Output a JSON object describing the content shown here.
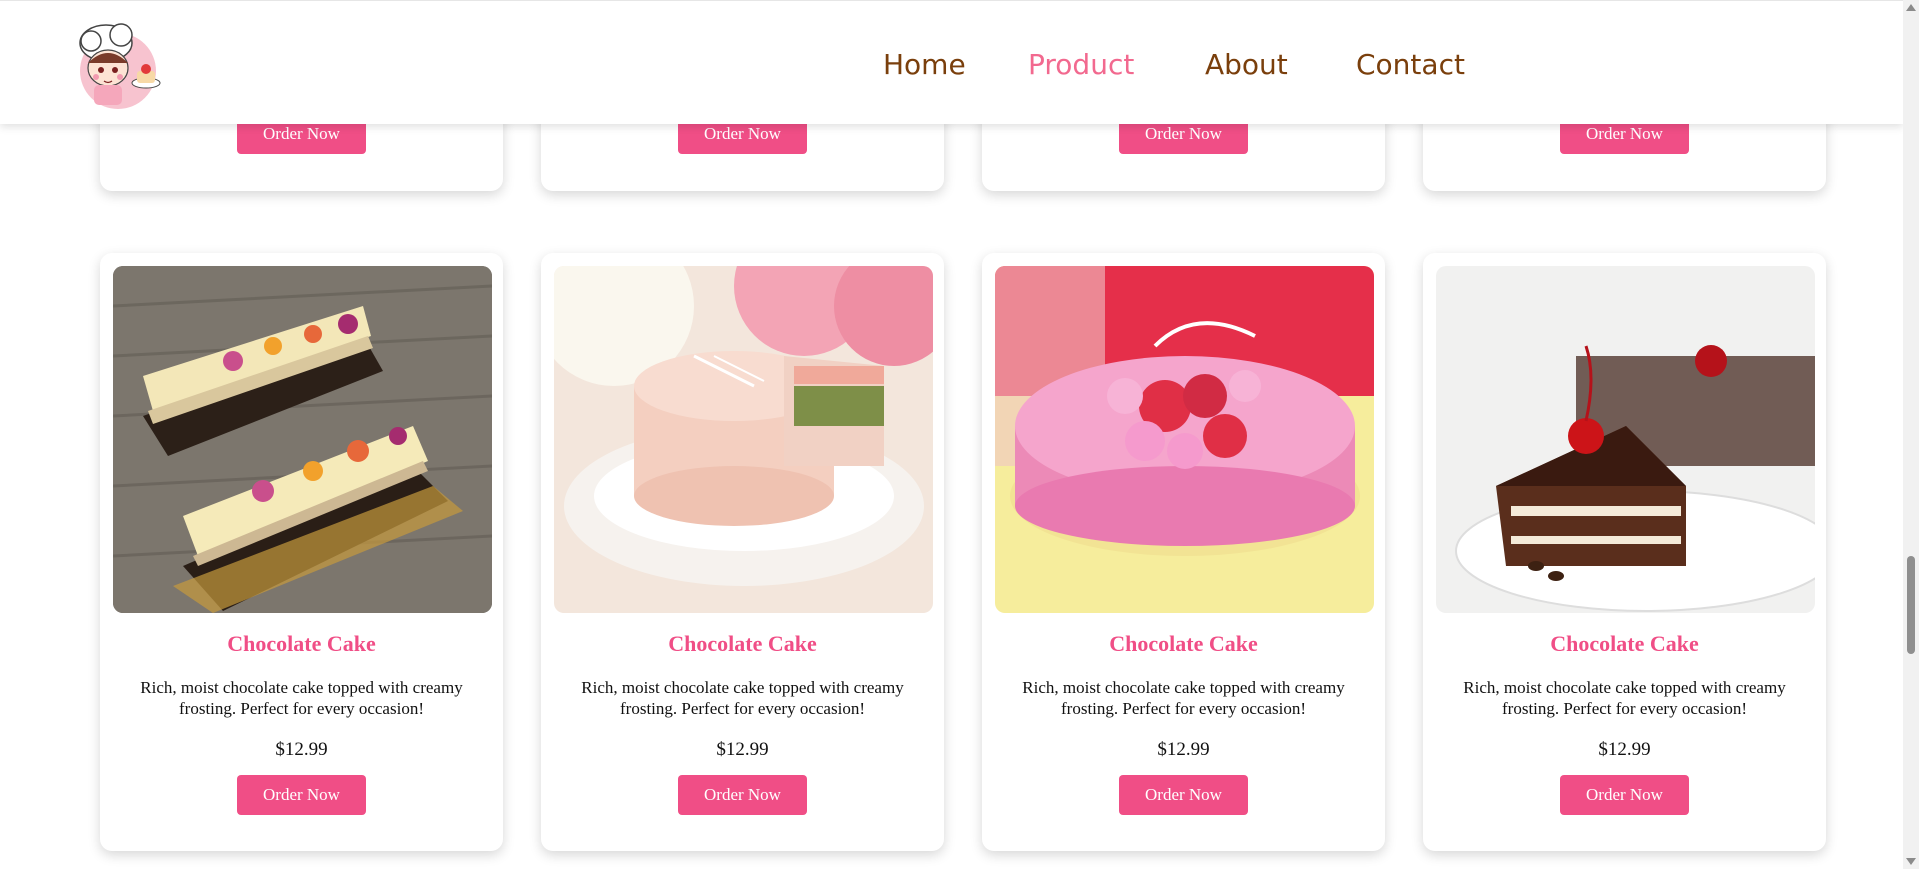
{
  "header": {
    "logo_icon": "chef-girl-logo",
    "nav": [
      {
        "label": "Home",
        "active": false
      },
      {
        "label": "Product",
        "active": true
      },
      {
        "label": "About",
        "active": false
      },
      {
        "label": "Contact",
        "active": false
      }
    ]
  },
  "top_row": [
    {
      "button": "Order Now"
    },
    {
      "button": "Order Now"
    },
    {
      "button": "Order Now"
    },
    {
      "button": "Order Now"
    }
  ],
  "products": [
    {
      "image_icon": "fruit-tart-icon",
      "title": "Chocolate Cake",
      "description": "Rich, moist chocolate cake topped with creamy frosting. Perfect for every occasion!",
      "price": "$12.99",
      "button": "Order Now"
    },
    {
      "image_icon": "peach-mousse-cake-icon",
      "title": "Chocolate Cake",
      "description": "Rich, moist chocolate cake topped with creamy frosting. Perfect for every occasion!",
      "price": "$12.99",
      "button": "Order Now"
    },
    {
      "image_icon": "strawberry-macaron-cake-icon",
      "title": "Chocolate Cake",
      "description": "Rich, moist chocolate cake topped with creamy frosting. Perfect for every occasion!",
      "price": "$12.99",
      "button": "Order Now"
    },
    {
      "image_icon": "black-forest-cake-icon",
      "title": "Chocolate Cake",
      "description": "Rich, moist chocolate cake topped with creamy frosting. Perfect for every occasion!",
      "price": "$12.99",
      "button": "Order Now"
    }
  ],
  "colors": {
    "accent": "#f04e86",
    "nav_text": "#7a3f0c",
    "nav_active": "#f2698f"
  }
}
